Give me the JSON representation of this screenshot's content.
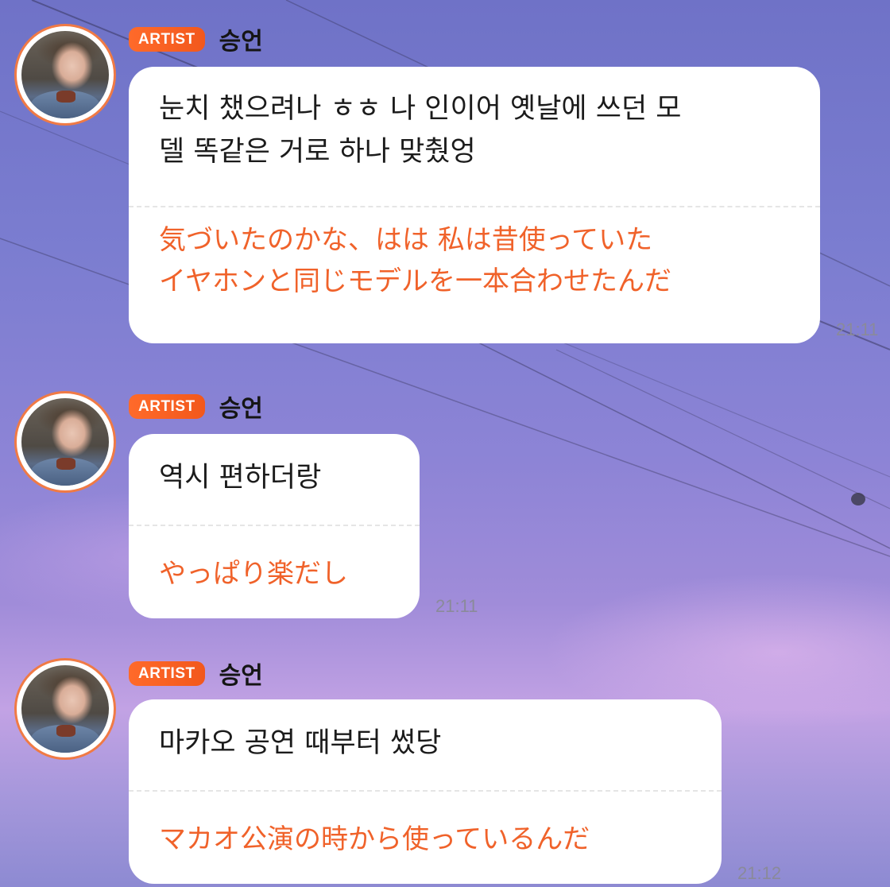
{
  "messages": [
    {
      "badge": "ARTIST",
      "author": "승언",
      "korean": "눈치 챘으려나 ㅎㅎ 나 인이어 옛날에 쓰던 모\n델 똑같은 거로 하나 맞췄엉",
      "japanese": "気づいたのかな、はは 私は昔使っていた\nイヤホンと同じモデルを一本合わせたんだ",
      "time": "21:11"
    },
    {
      "badge": "ARTIST",
      "author": "승언",
      "korean": "역시 편하더랑",
      "japanese": "やっぱり楽だし",
      "time": "21:11"
    },
    {
      "badge": "ARTIST",
      "author": "승언",
      "korean": "마카오 공연 때부터 썼당",
      "japanese": "マカオ公演の時から使っているんだ",
      "time": "21:12"
    }
  ],
  "colors": {
    "badge": "#f2581c",
    "translation": "#f0622a",
    "avatar_ring": "#f07a45"
  },
  "icons": {
    "avatar": "profile-photo"
  }
}
